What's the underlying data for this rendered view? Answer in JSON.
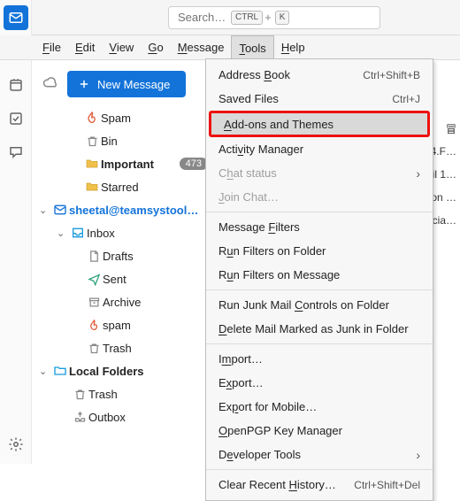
{
  "search": {
    "placeholder": "Search…",
    "kbd1": "CTRL",
    "kbd_plus": "+",
    "kbd2": "K"
  },
  "menubar": {
    "file": "File",
    "edit": "Edit",
    "view": "View",
    "go": "Go",
    "message": "Message",
    "tools": "Tools",
    "help": "Help"
  },
  "rail": {
    "mail": "mail",
    "contacts": "contacts",
    "calendar": "calendar",
    "tasks": "tasks",
    "chat": "chat",
    "settings": "settings"
  },
  "newmsg": "New Message",
  "tree": {
    "spam": "Spam",
    "bin": "Bin",
    "important": "Important",
    "important_badge": "473",
    "starred": "Starred",
    "account": "sheetal@teamsystool…",
    "inbox": "Inbox",
    "drafts": "Drafts",
    "sent": "Sent",
    "archive": "Archive",
    "spam2": "spam",
    "trash": "Trash",
    "local": "Local Folders",
    "local_trash": "Trash",
    "outbox": "Outbox"
  },
  "tools_menu": {
    "address_book": "Address Book",
    "address_book_sc": "Ctrl+Shift+B",
    "saved_files": "Saved Files",
    "saved_files_sc": "Ctrl+J",
    "addons": "Add-ons and Themes",
    "activity": "Activity Manager",
    "chat_status": "Chat status",
    "join_chat": "Join Chat…",
    "msg_filters": "Message Filters",
    "run_folder": "Run Filters on Folder",
    "run_message": "Run Filters on Message",
    "junk_controls": "Run Junk Mail Controls on Folder",
    "delete_junk": "Delete Mail Marked as Junk in Folder",
    "import": "Import…",
    "export": "Export…",
    "export_mobile": "Export for Mobile…",
    "openpgp": "OpenPGP Key Manager",
    "devtools": "Developer Tools",
    "clear_history": "Clear Recent History…",
    "clear_history_sc": "Ctrl+Shift+Del"
  },
  "preview": {
    "l1": "冒",
    "l2": "4.F…",
    "l3": "ril 1…",
    "l4": "on …",
    "l5": "cia…"
  },
  "underline_chars": {
    "file": "F",
    "edit": "E",
    "view": "V",
    "go": "G",
    "message": "M",
    "tools": "T",
    "help": "H",
    "addons_a": "A",
    "address_b": "B",
    "activity_v": "v",
    "chatstatus_h": "h",
    "join_j": "J",
    "filters_f": "F",
    "runfolder_u": "u",
    "runmsg_u": "u",
    "junk_c": "C",
    "deljunk_d": "D",
    "import_m": "m",
    "export_x": "x",
    "exportmob_p": "p",
    "openpgp_o": "O",
    "devtools_e": "e",
    "clear_h": "H"
  }
}
